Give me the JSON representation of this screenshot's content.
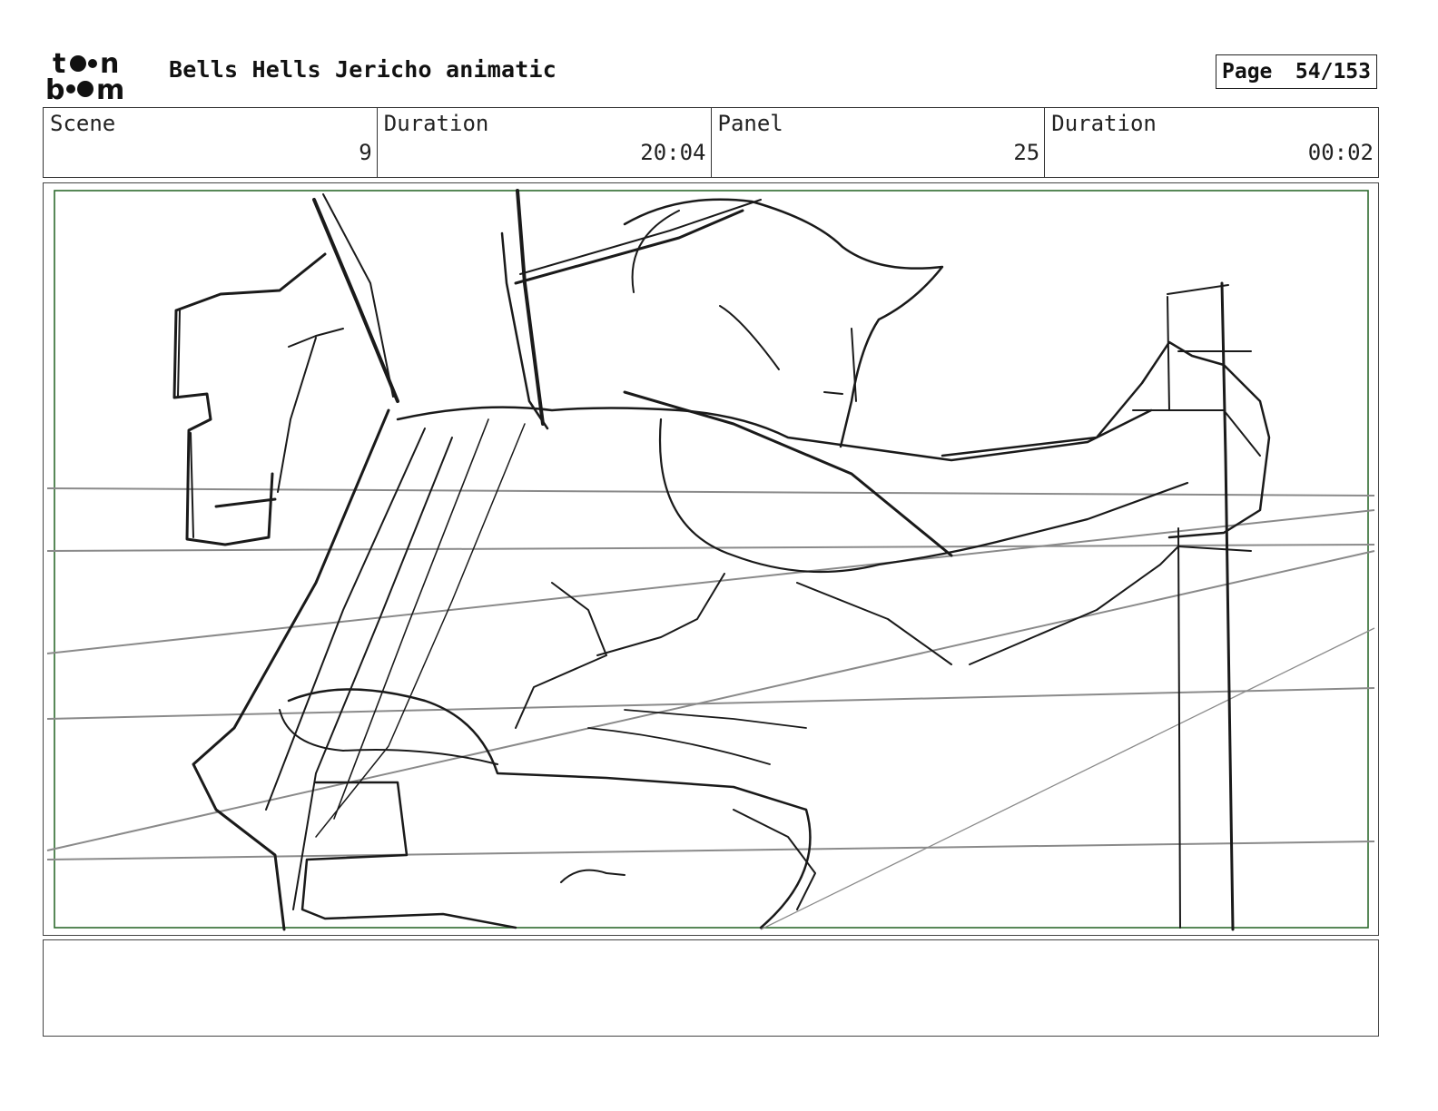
{
  "header": {
    "logo_text": "toon boom",
    "project_title": "Bells Hells Jericho animatic",
    "page_label": "Page",
    "page_number": "54/153"
  },
  "info": {
    "scene_label": "Scene",
    "scene_value": "9",
    "scene_duration_label": "Duration",
    "scene_duration_value": "20:04",
    "panel_label": "Panel",
    "panel_value": "25",
    "panel_duration_label": "Duration",
    "panel_duration_value": "00:02"
  },
  "colors": {
    "safe_area_border": "#2e6b2e",
    "sketch_dark": "#1a1a1a",
    "sketch_light": "#8a8a8a"
  },
  "notes": {
    "text": ""
  }
}
